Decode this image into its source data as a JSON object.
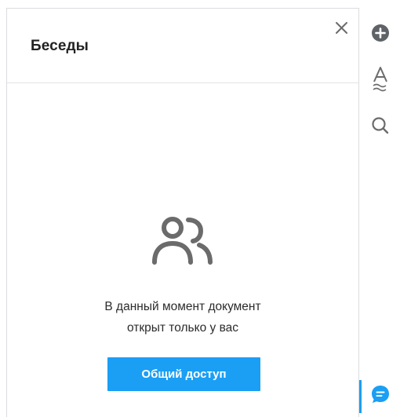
{
  "panel": {
    "title": "Беседы",
    "close_label": "Закрыть"
  },
  "empty_state": {
    "line1": "В данный момент документ",
    "line2": "открыт только у вас"
  },
  "share_button": {
    "label": "Общий доступ"
  },
  "right_bar": {
    "items": [
      {
        "name": "add-icon"
      },
      {
        "name": "text-format-icon"
      },
      {
        "name": "search-icon"
      },
      {
        "name": "chat-icon",
        "active": true
      }
    ]
  },
  "colors": {
    "accent": "#1a9ff4",
    "icon_gray": "#6b6b6b",
    "dark_icon": "#5f6368",
    "text": "#2b2b2b"
  }
}
